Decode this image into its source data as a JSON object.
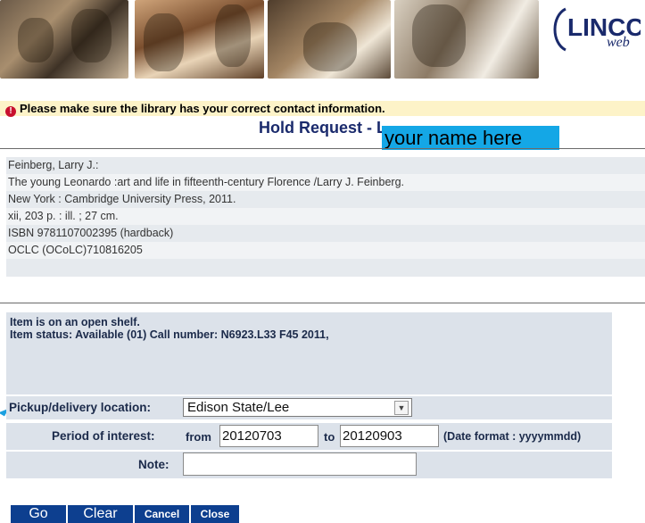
{
  "notice": {
    "text": "Please make sure the library has your correct contact information."
  },
  "title": {
    "text": "Hold Request - L",
    "name_overlay": "your name here"
  },
  "logo": {
    "text": "LINCC",
    "subtext": "web",
    "color": "#1a2a6c"
  },
  "bib": [
    "Feinberg, Larry J.:",
    "The young Leonardo :art and life in fifteenth-century Florence /Larry J. Feinberg.",
    "New York : Cambridge University Press, 2011.",
    "xii, 203 p. : ill. ; 27 cm.",
    "ISBN 9781107002395 (hardback)",
    "OCLC (OCoLC)710816205"
  ],
  "status": {
    "line1": "Item is on an open shelf.",
    "line2": "Item status: Available (01) Call number: N6923.L33 F45 2011,"
  },
  "form": {
    "pickup_label": "Pickup/delivery location:",
    "pickup_value": "Edison State/Lee",
    "period_label": "Period of interest:",
    "from_label": "from",
    "from_value": "20120703",
    "to_label": "to",
    "to_value": "20120903",
    "date_format": "(Date format : yyyymmdd)",
    "note_label": "Note:",
    "note_value": ""
  },
  "buttons": {
    "go": "Go",
    "clear": "Clear",
    "cancel": "Cancel",
    "close": "Close"
  },
  "colors": {
    "accent": "#0d3f8f",
    "highlight": "#14a7e6",
    "warning": "#c8102e",
    "title": "#1a2a6c"
  }
}
